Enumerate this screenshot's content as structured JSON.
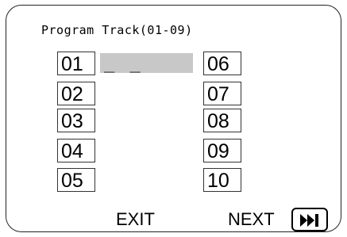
{
  "title": "Program Track(01-09)",
  "tracks_left": [
    "01",
    "02",
    "03",
    "04",
    "05"
  ],
  "tracks_right": [
    "06",
    "07",
    "08",
    "09",
    "10"
  ],
  "entry_value": "_ _",
  "buttons": {
    "exit_label": "EXIT",
    "next_label": "NEXT",
    "skip_icon": "skip-next-icon"
  }
}
